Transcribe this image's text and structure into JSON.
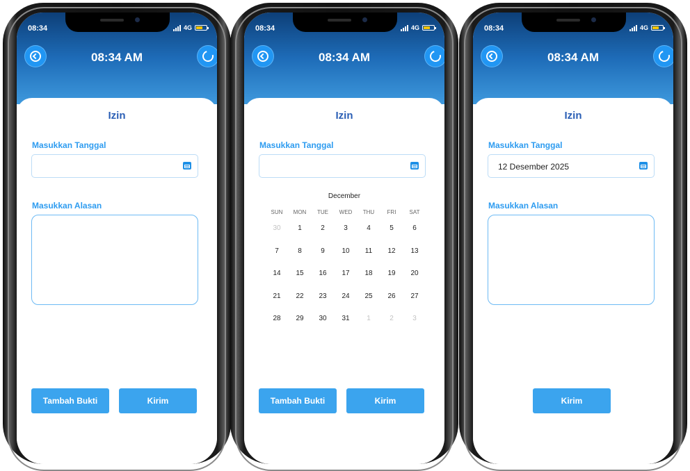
{
  "phones": [
    {
      "status_time": "08:34",
      "network": "4G",
      "clock": "08:34 AM",
      "title": "Izin",
      "date_label": "Masukkan Tanggal",
      "date_value": "",
      "reason_label": "Masukkan Alasan",
      "buttons": {
        "add_proof": "Tambah Bukti",
        "send": "Kirim"
      }
    },
    {
      "status_time": "08:34",
      "network": "4G",
      "clock": "08:34 AM",
      "title": "Izin",
      "date_label": "Masukkan Tanggal",
      "date_value": "",
      "calendar": {
        "month": "December",
        "weekdays": [
          "SUN",
          "MON",
          "TUE",
          "WED",
          "THU",
          "FRI",
          "SAT"
        ],
        "weeks": [
          [
            "30",
            "1",
            "2",
            "3",
            "4",
            "5",
            "6"
          ],
          [
            "7",
            "8",
            "9",
            "10",
            "11",
            "12",
            "13"
          ],
          [
            "14",
            "15",
            "16",
            "17",
            "18",
            "19",
            "20"
          ],
          [
            "21",
            "22",
            "23",
            "24",
            "25",
            "26",
            "27"
          ],
          [
            "28",
            "29",
            "30",
            "31",
            "1",
            "2",
            "3"
          ]
        ],
        "outside_month": [
          [
            0,
            0
          ],
          [
            4,
            4
          ],
          [
            4,
            5
          ],
          [
            4,
            6
          ]
        ]
      },
      "buttons": {
        "add_proof": "Tambah Bukti",
        "send": "Kirim"
      }
    },
    {
      "status_time": "08:34",
      "network": "4G",
      "clock": "08:34 AM",
      "title": "Izin",
      "date_label": "Masukkan Tanggal",
      "date_value": "12 Desember 2025",
      "reason_label": "Masukkan Alasan",
      "buttons": {
        "send": "Kirim"
      }
    }
  ],
  "colors": {
    "header_top": "#0d3f78",
    "header_bottom": "#3e99dd",
    "accent": "#3ba4ee",
    "title": "#2b5fb5",
    "label": "#2e9cf0"
  },
  "icons": [
    "back-arrow-icon",
    "refresh-icon",
    "calendar-icon",
    "signal-icon",
    "battery-icon"
  ]
}
